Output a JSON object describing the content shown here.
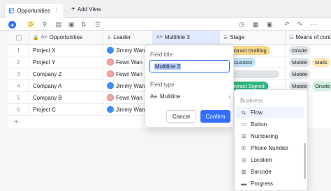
{
  "tabs": {
    "active_label": "Opportunities",
    "more": "⋮",
    "add_view": "Add View"
  },
  "columns": [
    {
      "icon": "A≡",
      "label": "Opportunities"
    },
    {
      "icon": "♙",
      "label": "Leader"
    },
    {
      "icon": "A≡",
      "label": "Multiline 3"
    },
    {
      "icon": "☰",
      "label": "Stage"
    },
    {
      "icon": "☷",
      "label": "Means of contact"
    }
  ],
  "rows": [
    {
      "num": "1",
      "name": "Project X",
      "leader": "Jimmy Wang",
      "stage": "Contract Drafting",
      "means": [
        "Onsite"
      ]
    },
    {
      "num": "2",
      "name": "Project Y",
      "leader": "Fewn Wan",
      "stage": "Discussion",
      "means": [
        "Mobile",
        "Mails"
      ]
    },
    {
      "num": "3",
      "name": "Company Z",
      "leader": "Fewn Wan",
      "stage": "",
      "means": [
        "Mobile"
      ]
    },
    {
      "num": "4",
      "name": "Company A",
      "leader": "Jimmy Wang",
      "stage": "Contract Signed",
      "means": [
        "Mobile",
        "Onsite"
      ]
    },
    {
      "num": "5",
      "name": "Company B",
      "leader": "Fewn Wan",
      "stage": "",
      "means": []
    },
    {
      "num": "6",
      "name": "Project C",
      "leader": "Jimmy Wang",
      "stage": "",
      "means": []
    }
  ],
  "add_row": "+",
  "field_popup": {
    "title_label": "Field title",
    "title_value": "Multiline 3",
    "type_label": "Field type",
    "type_icon": "A≡",
    "type_value": "Multiline",
    "cancel": "Cancel",
    "confirm": "Confirm"
  },
  "type_menu": {
    "group": "Business",
    "items": [
      {
        "icon": "⇆",
        "label": "Flow"
      },
      {
        "icon": "▭",
        "label": "Button"
      },
      {
        "icon": "☰",
        "label": "Numbering"
      },
      {
        "icon": "✆",
        "label": "Phone Number"
      },
      {
        "icon": "◎",
        "label": "Location"
      },
      {
        "icon": "▥",
        "label": "Barcode"
      },
      {
        "icon": "▬",
        "label": "Progress"
      }
    ]
  },
  "colors": {
    "accent": "#3370ff",
    "stage_drafting": "#f8d98c",
    "stage_discussion": "#bfe3f7",
    "stage_signed": "#2fb57b",
    "blue_leader": "#3c8cff",
    "pink_leader": "#f2a7a7"
  }
}
